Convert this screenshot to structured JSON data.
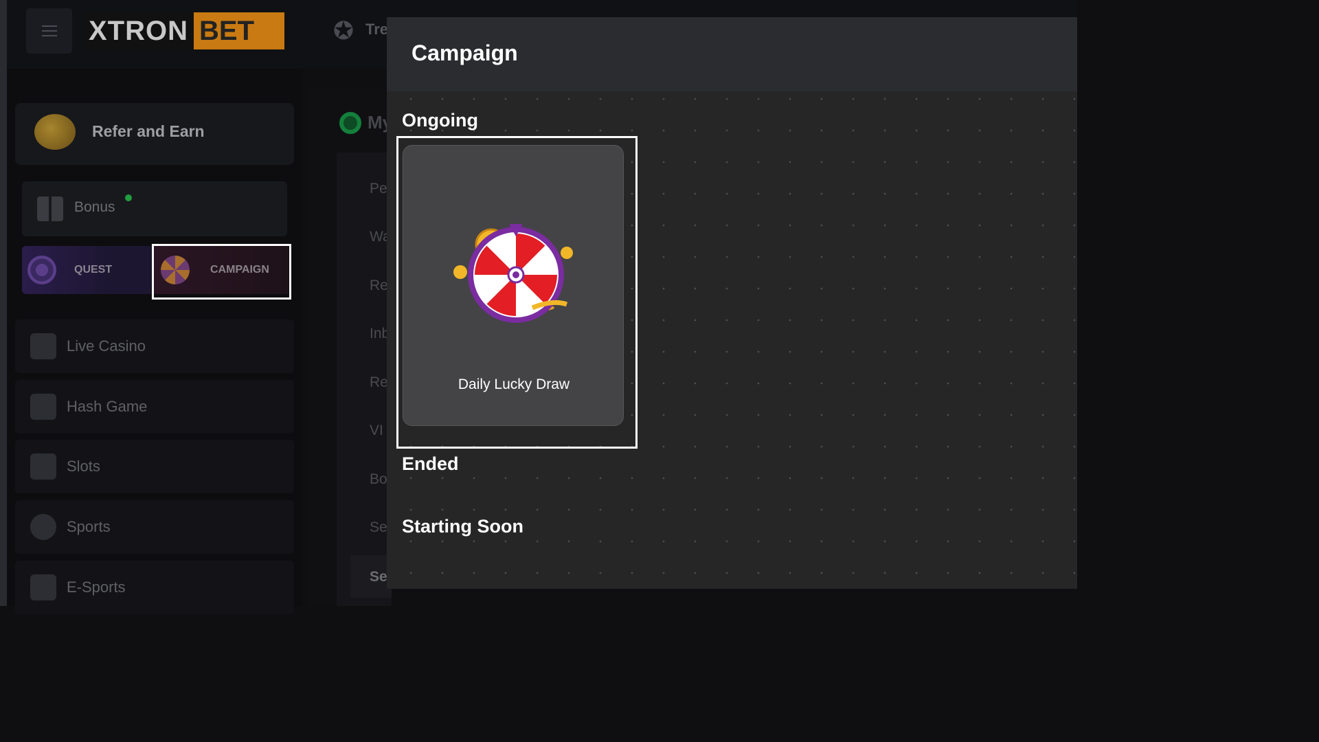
{
  "header": {
    "logo_text_1": "XTRON",
    "logo_text_2": "BET",
    "nav_partial": "Tre"
  },
  "sidebar": {
    "refer": "Refer and Earn",
    "bonus": "Bonus",
    "quest": "QUEST",
    "campaign": "CAMPAIGN",
    "items": [
      {
        "label": "Live Casino",
        "icon": "live-casino-icon"
      },
      {
        "label": "Hash Game",
        "icon": "slot-machine-icon"
      },
      {
        "label": "Slots",
        "icon": "seven-icon"
      },
      {
        "label": "Sports",
        "icon": "basketball-icon"
      },
      {
        "label": "E-Sports",
        "icon": "esports-sword-icon"
      }
    ]
  },
  "background_panel": {
    "title": "My",
    "items": [
      "Pe",
      "Wa",
      "Re",
      "Inb",
      "Re",
      "VI",
      "Bo",
      "Se"
    ],
    "selected": "Se"
  },
  "modal": {
    "title": "Campaign",
    "sections": {
      "ongoing": "Ongoing",
      "ended": "Ended",
      "starting_soon": "Starting Soon"
    },
    "ongoing_cards": [
      {
        "title": "Daily Lucky Draw",
        "icon": "prize-wheel-icon"
      }
    ]
  },
  "colors": {
    "modal_bg": "#262627",
    "card_bg": "#444446",
    "brand_orange": "#c97a12",
    "notification_dot": "#1f9d3f"
  }
}
